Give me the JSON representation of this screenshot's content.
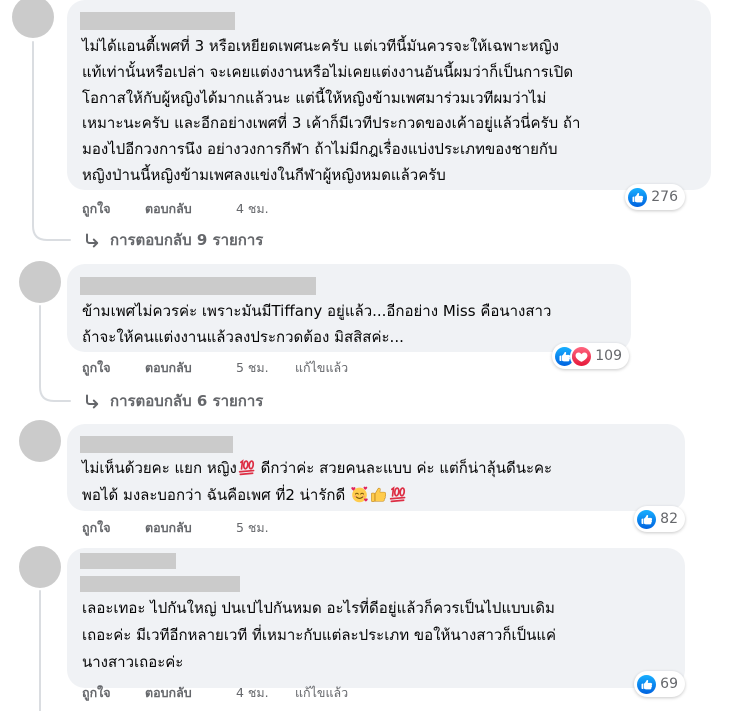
{
  "colors": {
    "bubble": "#f0f2f5",
    "text": "#050505",
    "secondary_text": "#65676b",
    "like_blue": "#1877f2",
    "love_red": "#f33e58",
    "redaction_gray": "#cbcbcb"
  },
  "comments": [
    {
      "lines": [
        "ไม่ได้แอนตี้เพศที่ 3 หรือเหยียดเพศนะครับ แต่เวทีนี้มันควรจะให้เฉพาะหญิง",
        "แท้เท่านั้นหรือเปล่า จะเคยแต่งงานหรือไม่เคยแต่งงานอันนี้ผมว่าก็เป็นการเปิด",
        "โอกาสให้กับผู้หญิงได้มากแล้วนะ แต่นี้ให้หญิงข้ามเพศมาร่วมเวทีผมว่าไม่",
        "เหมาะนะครับ และอีกอย่างเพศที่ 3 เค้าก็มีเวทีประกวดของเค้าอยู่แล้วนี่ครับ ถ้า",
        "มองไปอีกวงการนึง อย่างวงการกีฬา ถ้าไม่มีกฎเรื่องแบ่งประเภทของชายกับ",
        "หญิงป่านนี้หญิงข้ามเพศลงแข่งในกีฬาผู้หญิงหมดแล้วครับ"
      ],
      "reactions": {
        "icons": [
          "like-icon"
        ],
        "count": "276"
      },
      "actions": {
        "like": "ถูกใจ",
        "reply": "ตอบกลับ",
        "time": "4 ชม."
      },
      "replies_link": {
        "icon": "reply-arrow-icon",
        "label": "การตอบกลับ 9 รายการ"
      }
    },
    {
      "lines": [
        "ข้ามเพศไม่ควรค่ะ เพราะมันมีTiffany อยู่แล้ว...อีกอย่าง Miss คือนางสาว",
        "ถ้าจะให้คนแต่งงานแล้วลงประกวดต้อง มิสสิสค่ะ..."
      ],
      "reactions": {
        "icons": [
          "like-icon",
          "love-icon"
        ],
        "count": "109"
      },
      "actions": {
        "like": "ถูกใจ",
        "reply": "ตอบกลับ",
        "time": "5 ชม.",
        "edited": "แก้ไขแล้ว"
      },
      "replies_link": {
        "icon": "reply-arrow-icon",
        "label": "การตอบกลับ 6 รายการ"
      }
    },
    {
      "lines": [
        [
          "ไม่เห็นด้วยคะ แยก หญิง",
          {
            "emoji": "hundred-points-emoji"
          },
          " ดีกว่าค่ะ สวยคนละแบบ ค่ะ แต่ก็น่าลุ้นดีนะคะ"
        ],
        [
          "พอได้ มงละบอกว่า ฉันคือเพศ ที่2 น่ารักดี ",
          {
            "emoji": "smiling-face-with-hearts-emoji"
          },
          {
            "emoji": "thumbs-up-emoji"
          },
          {
            "emoji": "hundred-points-emoji"
          }
        ]
      ],
      "reactions": {
        "icons": [
          "like-icon"
        ],
        "count": "82"
      },
      "actions": {
        "like": "ถูกใจ",
        "reply": "ตอบกลับ",
        "time": "5 ชม."
      }
    },
    {
      "lines": [
        "เลอะเทอะ ไปกันใหญ่ ปนเปไปกันหมด อะไรที่ดีอยู่แล้วก็ควรเป็นไปแบบเดิม",
        "เถอะค่ะ มีเวทีอีกหลายเวที ที่เหมาะกับแต่ละประเภท ขอให้นางสาวก็เป็นแค่",
        "นางสาวเถอะค่ะ"
      ],
      "reactions": {
        "icons": [
          "like-icon"
        ],
        "count": "69"
      },
      "actions": {
        "like": "ถูกใจ",
        "reply": "ตอบกลับ",
        "time": "4 ชม.",
        "edited": "แก้ไขแล้ว"
      }
    }
  ]
}
